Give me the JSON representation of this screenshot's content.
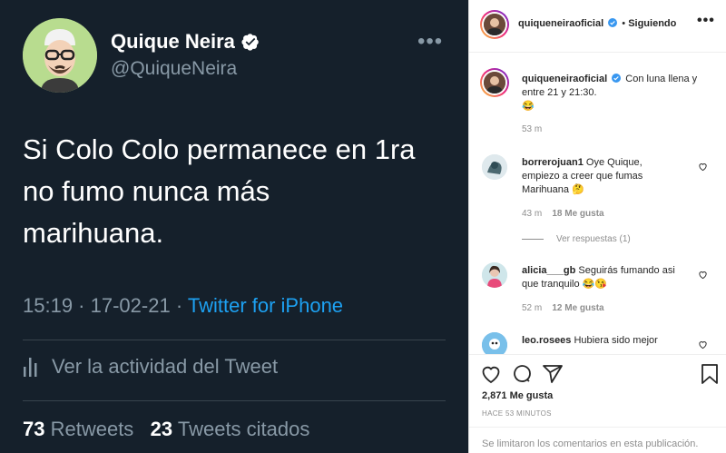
{
  "tweet": {
    "author_name": "Quique Neira",
    "handle": "@QuiqueNeira",
    "more_icon": "more-horizontal-icon",
    "text_lines": [
      "Si Colo Colo permanece en 1ra",
      "no fumo nunca más",
      "marihuana."
    ],
    "time": "15:19",
    "dot1": " · ",
    "date": "17-02-21",
    "dot2": " · ",
    "source": "Twitter for iPhone",
    "activity_label": "Ver la actividad del Tweet",
    "retweets_count": "73",
    "retweets_label": " Retweets",
    "quotes_count": "23",
    "quotes_label": " Tweets citados",
    "colors": {
      "background": "#15202b",
      "link": "#1da1f2",
      "muted": "#8899a6"
    }
  },
  "instagram": {
    "header": {
      "username": "quiqueneiraoficial",
      "separator": "•",
      "follow_status": "Siguiendo",
      "more_icon": "more-horizontal-icon"
    },
    "caption": {
      "username": "quiqueneiraoficial",
      "text_line1": "Con luna llena y",
      "text_line2": "entre 21 y 21:30.",
      "emoji": "😂",
      "time": "53 m"
    },
    "comments": [
      {
        "username": "borrerojuan1",
        "text_line1": "Oye Quique,",
        "text_line2": "empiezo a creer que fumas",
        "text_line3": "Marihuana",
        "emoji": "🤔",
        "time": "43 m",
        "likes": "18 Me gusta"
      },
      {
        "username": "alicia___gb",
        "text_line1": "Seguirás fumando asi",
        "text_line2": "que tranquilo",
        "emoji": "😂😘",
        "time": "52 m",
        "likes": "12 Me gusta"
      },
      {
        "username": "leo.rosees",
        "text_line1": "Hubiera sido mejor"
      }
    ],
    "view_replies": "Ver respuestas (1)",
    "likes_total": "2,871 Me gusta",
    "posted_ago": "HACE 53 MINUTOS",
    "comments_limited": "Se limitaron los comentarios en esta publicación.",
    "colors": {
      "text": "#262626",
      "muted": "#8e8e8e",
      "border": "#dbdbdb"
    }
  }
}
